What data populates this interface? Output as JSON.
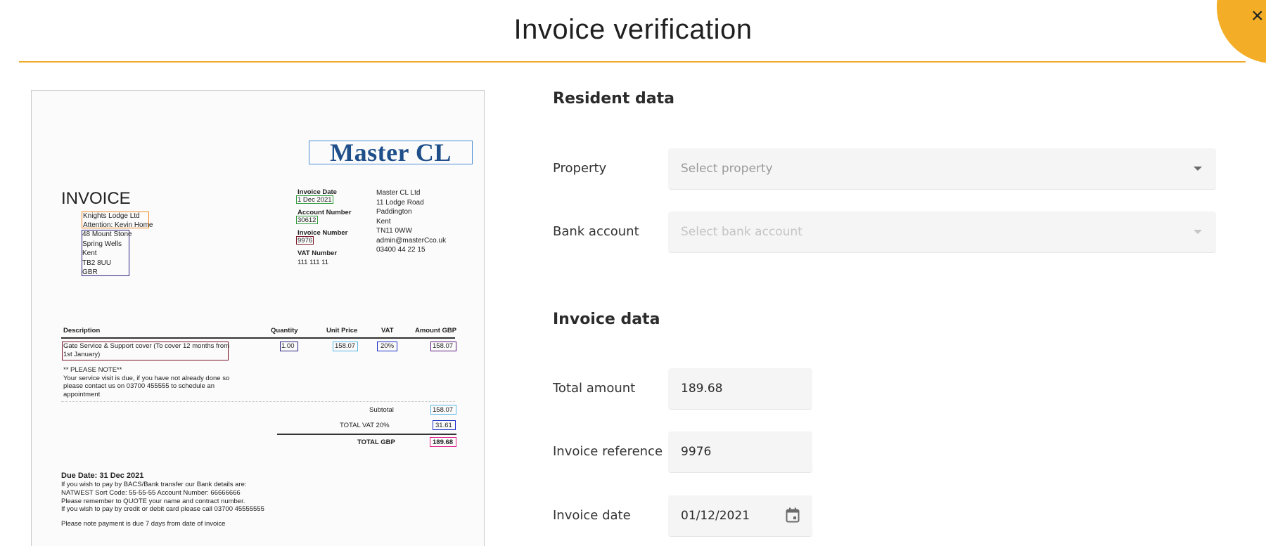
{
  "header": {
    "title": "Invoice verification",
    "close_glyph": "×"
  },
  "document": {
    "logo_text": "Master CL",
    "heading": "INVOICE",
    "addressee": {
      "company": "Knights Lodge Ltd",
      "attention": "Attention: Kevin Home",
      "address_lines": [
        "48 Mount Stone",
        "Spring Wells",
        "Kent",
        "TB2 8UU",
        "GBR"
      ]
    },
    "meta": {
      "invoice_date_label": "Invoice Date",
      "invoice_date": "1 Dec 2021",
      "account_number_label": "Account Number",
      "account_number": "30612",
      "invoice_number_label": "Invoice Number",
      "invoice_number": "9976",
      "vat_number_label": "VAT Number",
      "vat_number": "111 111 11"
    },
    "sender": {
      "lines": [
        "Master CL Ltd",
        "11 Lodge Road",
        "Paddington",
        "Kent",
        "TN11 0WW",
        "admin@masterCco.uk",
        "03400 44 22 15"
      ]
    },
    "table": {
      "headers": [
        "Description",
        "Quantity",
        "Unit Price",
        "VAT",
        "Amount GBP"
      ],
      "row": {
        "description_line1": "Gate Service & Support cover (To cover 12 months from",
        "description_line2": "1st January)",
        "quantity": "1.00",
        "unit_price": "158.07",
        "vat": "20%",
        "amount": "158.07"
      },
      "note": [
        "** PLEASE NOTE**",
        "Your service visit is due, if you have not already done so",
        "please contact us on 03700 455555 to schedule an",
        "appointment"
      ]
    },
    "totals": {
      "subtotal_label": "Subtotal",
      "subtotal": "158.07",
      "total_vat_label": "TOTAL VAT  20%",
      "total_vat": "31.61",
      "total_label": "TOTAL GBP",
      "total": "189.68"
    },
    "footer": {
      "due_date": "Due Date: 31 Dec 2021",
      "lines": [
        "If you wish to pay by BACS/Bank transfer our Bank details are:",
        "NATWEST Sort Code: 55-55-55 Account Number: 66666666",
        "Please remember to QUOTE your name and contract number.",
        "If you wish to pay by credit or debit card please call 03700 45555555"
      ],
      "payment_note": "Please note payment is due 7 days from date of invoice"
    }
  },
  "resident": {
    "section_title": "Resident data",
    "property_label": "Property",
    "property_placeholder": "Select property",
    "bank_label": "Bank account",
    "bank_placeholder": "Select bank account"
  },
  "invoice": {
    "section_title": "Invoice data",
    "total_label": "Total amount",
    "total_value": "189.68",
    "reference_label": "Invoice reference",
    "reference_value": "9976",
    "date_label": "Invoice date",
    "date_value": "01/12/2021"
  },
  "colors": {
    "accent": "#f3ad26",
    "box_orange": "#f08a24",
    "box_green": "#2e9a3a",
    "box_darkred": "#7a1428",
    "box_navy": "#2b2280",
    "box_blue": "#1b2ec8",
    "box_lightblue": "#55b6e6",
    "box_purple": "#5a1a7a",
    "box_magenta": "#e0208a"
  },
  "icons": {
    "close": "close-icon",
    "dropdown": "chevron-down-icon",
    "calendar": "calendar-icon"
  }
}
